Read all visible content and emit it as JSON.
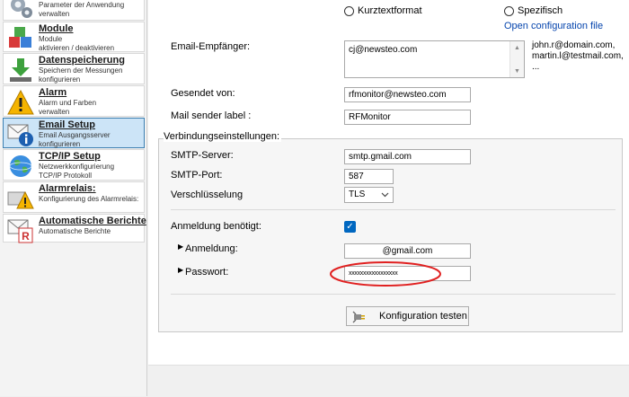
{
  "sidebar": {
    "items": [
      {
        "title": "",
        "desc": "Parameter der Anwendung\nverwalten",
        "icon": "gears-icon"
      },
      {
        "title": "Module",
        "desc": "Module\naktivieren / deaktivieren",
        "icon": "cubes-icon"
      },
      {
        "title": "Datenspeicherung",
        "desc": "Speichern der Messungen\nkonfigurieren",
        "icon": "download-icon"
      },
      {
        "title": "Alarm",
        "desc": "Alarm und Farben\nverwalten",
        "icon": "warning-icon"
      },
      {
        "title": "Email Setup",
        "desc": "Email Ausgangsserver\nkonfigurieren",
        "icon": "email-info-icon"
      },
      {
        "title": "TCP/IP Setup",
        "desc": "Netzwerkkonfigurierung\nTCP/IP Protokoll",
        "icon": "globe-icon"
      },
      {
        "title": "Alarmrelais:",
        "desc": "Konfigurierung des Alarmrelais:",
        "icon": "relay-warning-icon"
      },
      {
        "title": "Automatische Berichte",
        "desc": "Automatische Berichte",
        "icon": "report-icon"
      }
    ]
  },
  "format": {
    "radio_short": "Kurztextformat",
    "radio_specific": "Spezifisch",
    "open_config_link": "Open configuration file"
  },
  "email": {
    "recipient_label": "Email-Empfänger:",
    "recipient_value": "cj@newsteo.com",
    "recipient_hint": "john.r@domain.com,\nmartin.l@testmail.com,\n...",
    "sent_from_label": "Gesendet von:",
    "sent_from_value": "rfmonitor@newsteo.com",
    "sender_label_label": "Mail sender label :",
    "sender_label_value": "RFMonitor"
  },
  "connection": {
    "section_title": "Verbindungseinstellungen:",
    "smtp_server_label": "SMTP-Server:",
    "smtp_server_value": "smtp.gmail.com",
    "smtp_port_label": "SMTP-Port:",
    "smtp_port_value": "587",
    "encryption_label": "Verschlüsselung",
    "encryption_value": "TLS",
    "auth_required_label": "Anmeldung benötigt:",
    "auth_required_checked": "✓",
    "login_label": "Anmeldung:",
    "login_value": "@gmail.com",
    "password_label": "Passwort:",
    "password_value": "xxxxxxxxxxxxxxxxx",
    "test_button_label": "Konfiguration testen"
  },
  "colors": {
    "selected_bg": "#cce4f7",
    "selected_border": "#3c7fb1",
    "link": "#0645ad",
    "checkbox": "#0067c0",
    "annotation_circle": "#e02020"
  }
}
